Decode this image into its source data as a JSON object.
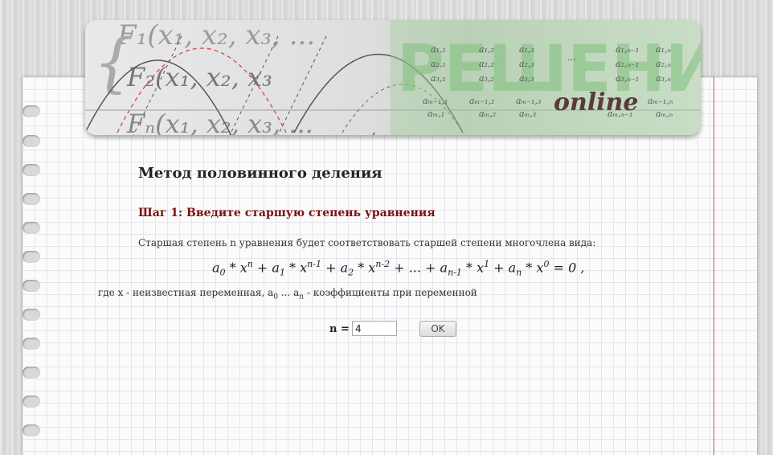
{
  "banner": {
    "bg_left_formula": "F₁(x₁, x₂, x₃, ...",
    "brand_watermark": "РЕШЕНИЕ",
    "brand_script": "online"
  },
  "main": {
    "title": "Метод половинного деления",
    "step_title": "Шаг 1: Введите старшую степень уравнения",
    "description": "Старшая степень n уравнения будет соответствовать старшей степени многочлена вида:",
    "formula": {
      "a0": "a",
      "s0": "0",
      "x0": " * x",
      "e0": "n",
      "a1": " + a",
      "s1": "1",
      "x1": " * x",
      "e1": "n-1",
      "a2": " + a",
      "s2": "2",
      "x2": " * x",
      "e2": "n-2",
      "dots": " + ... + a",
      "s3": "n-1",
      "x3": " * x",
      "e3": "1",
      "a4": " + a",
      "s4": "n",
      "x4": " * x",
      "e4": "0",
      "tail": " = 0 ,"
    },
    "note_prefix": "где x - неизвестная переменная, a",
    "note_sub0": "0",
    "note_mid": " ... a",
    "note_subn": "n",
    "note_suffix": " - коэффициенты при переменной"
  },
  "form": {
    "n_label": "n =",
    "n_value": "4",
    "ok_label": "OK"
  },
  "colors": {
    "step_title": "#7a1010",
    "margin_line": "#b9585e",
    "brand_green": "#6aa86a"
  }
}
